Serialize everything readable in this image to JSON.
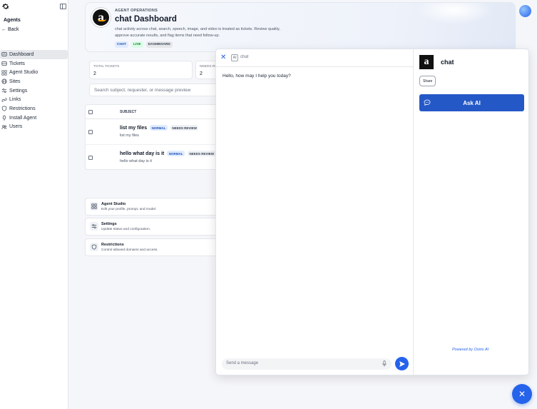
{
  "sidebar": {
    "title": "Agents",
    "back_label": "Back",
    "items": [
      {
        "label": "Dashboard",
        "icon": "dashboard-icon",
        "active": true
      },
      {
        "label": "Tickets",
        "icon": "tickets-icon"
      },
      {
        "label": "Agent Studio",
        "icon": "grid-icon"
      },
      {
        "label": "Sites",
        "icon": "globe-icon"
      },
      {
        "label": "Settings",
        "icon": "sliders-icon"
      },
      {
        "label": "Links",
        "icon": "link-icon"
      },
      {
        "label": "Restrictions",
        "icon": "shield-icon"
      },
      {
        "label": "Install Agent",
        "icon": "rocket-icon"
      },
      {
        "label": "Users",
        "icon": "users-icon"
      }
    ]
  },
  "hero": {
    "kicker": "AGENT OPERATIONS",
    "title": "chat Dashboard",
    "description": "chat activity across chat, search, speech, image, and video is treated as tickets. Review quality, approve accurate results, and flag items that need follow-up.",
    "tags": [
      "CHAT",
      "LIVE",
      "DASHBOARD"
    ]
  },
  "stats": {
    "total_label": "TOTAL TICKETS",
    "total_value": "2",
    "needs_label": "NEEDS RE",
    "needs_value": "2"
  },
  "search": {
    "placeholder": "Search subject, requester, or message preview"
  },
  "table": {
    "header_subject": "SUBJECT",
    "rows": [
      {
        "title": "list my files",
        "priority": "NORMAL",
        "status": "NEEDS REVIEW",
        "preview": "list my files"
      },
      {
        "title": "hello what day is it",
        "priority": "NORMAL",
        "status": "NEEDS REVIEW",
        "preview": "hello what day is it"
      }
    ]
  },
  "link_cards": [
    {
      "title": "Agent Studio",
      "subtitle": "Edit your profile, prompt, and model.",
      "icon": "grid-icon"
    },
    {
      "title": "Settings",
      "subtitle": "Update status and configuration.",
      "icon": "sliders-icon"
    },
    {
      "title": "Restrictions",
      "subtitle": "Control allowed domains and access.",
      "icon": "shield-icon"
    }
  ],
  "chat": {
    "ai_badge": "AI",
    "label": "chat",
    "greeting": "Hello, how may I help you today?",
    "input_placeholder": "Send a message"
  },
  "side_panel": {
    "title": "chat",
    "share_label": "Share",
    "ask_label": "Ask AI",
    "powered_by": "Powered by Osiris AI"
  },
  "colors": {
    "accent": "#2563eb",
    "ask_button": "#2558c7"
  }
}
